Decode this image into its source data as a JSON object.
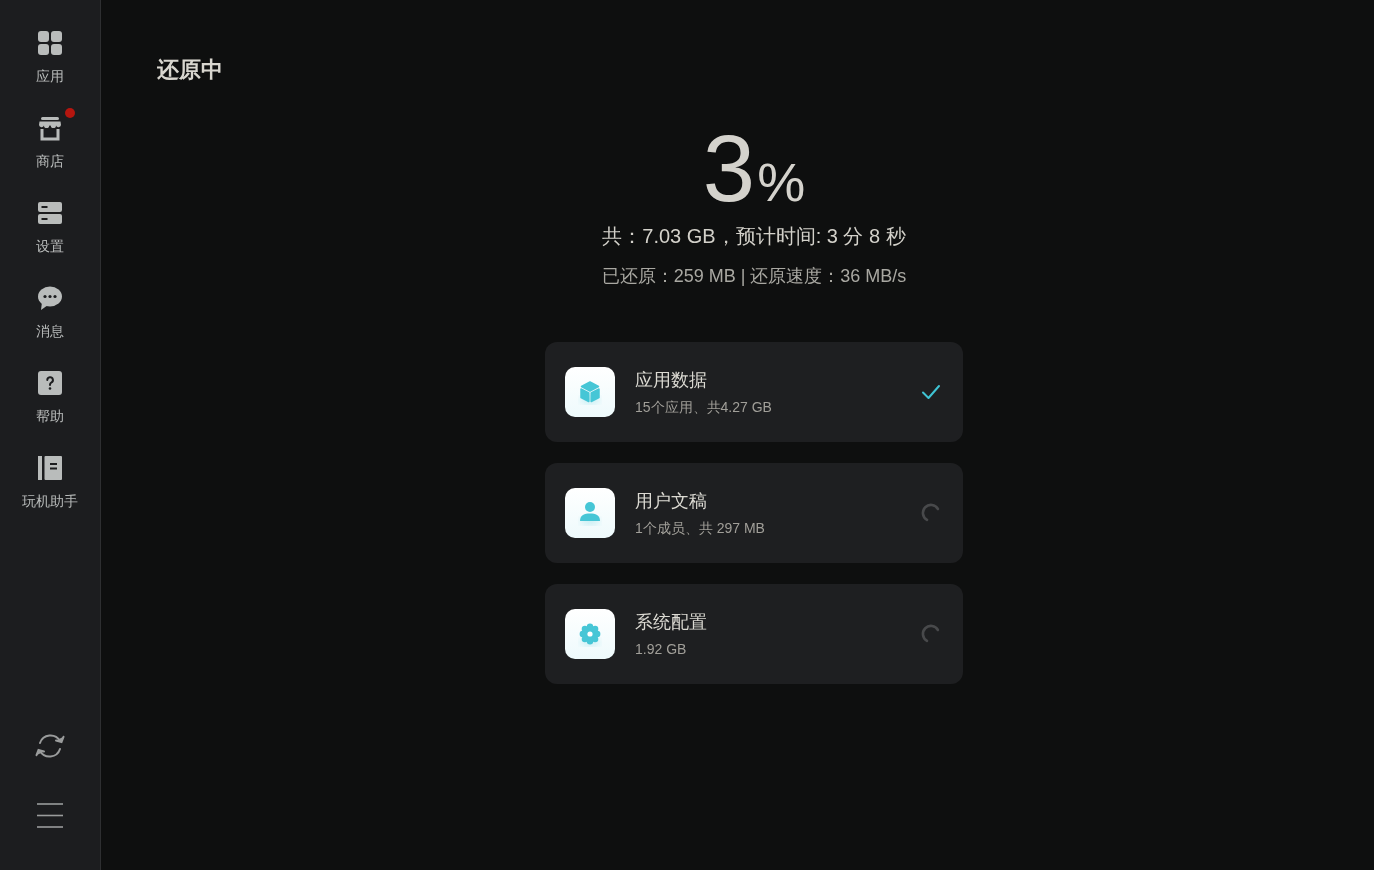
{
  "sidebar": {
    "items": [
      {
        "kind": "grid",
        "label": "应用",
        "selected": false,
        "badge": false
      },
      {
        "kind": "store",
        "label": "商店",
        "selected": false,
        "badge": true
      },
      {
        "kind": "server",
        "label": "设置",
        "selected": false,
        "badge": false
      },
      {
        "kind": "chat",
        "label": "消息",
        "selected": false,
        "badge": false
      },
      {
        "kind": "help",
        "label": "帮助",
        "selected": false,
        "badge": false
      },
      {
        "kind": "book",
        "label": "玩机助手",
        "selected": false,
        "badge": false
      }
    ]
  },
  "page_title": "还原中",
  "progress": {
    "value": "3",
    "unit": "%",
    "summary": "共：7.03 GB，预计时间: 3 分 8 秒",
    "detail": "已还原：259 MB | 还原速度：36 MB/s"
  },
  "items": [
    {
      "kind": "box",
      "title": "应用数据",
      "subtitle": "15个应用、共4.27 GB",
      "done": true
    },
    {
      "kind": "person",
      "title": "用户文稿",
      "subtitle": "1个成员、共 297 MB",
      "done": false
    },
    {
      "kind": "gear",
      "title": "系统配置",
      "subtitle": "1.92 GB",
      "done": false
    }
  ]
}
